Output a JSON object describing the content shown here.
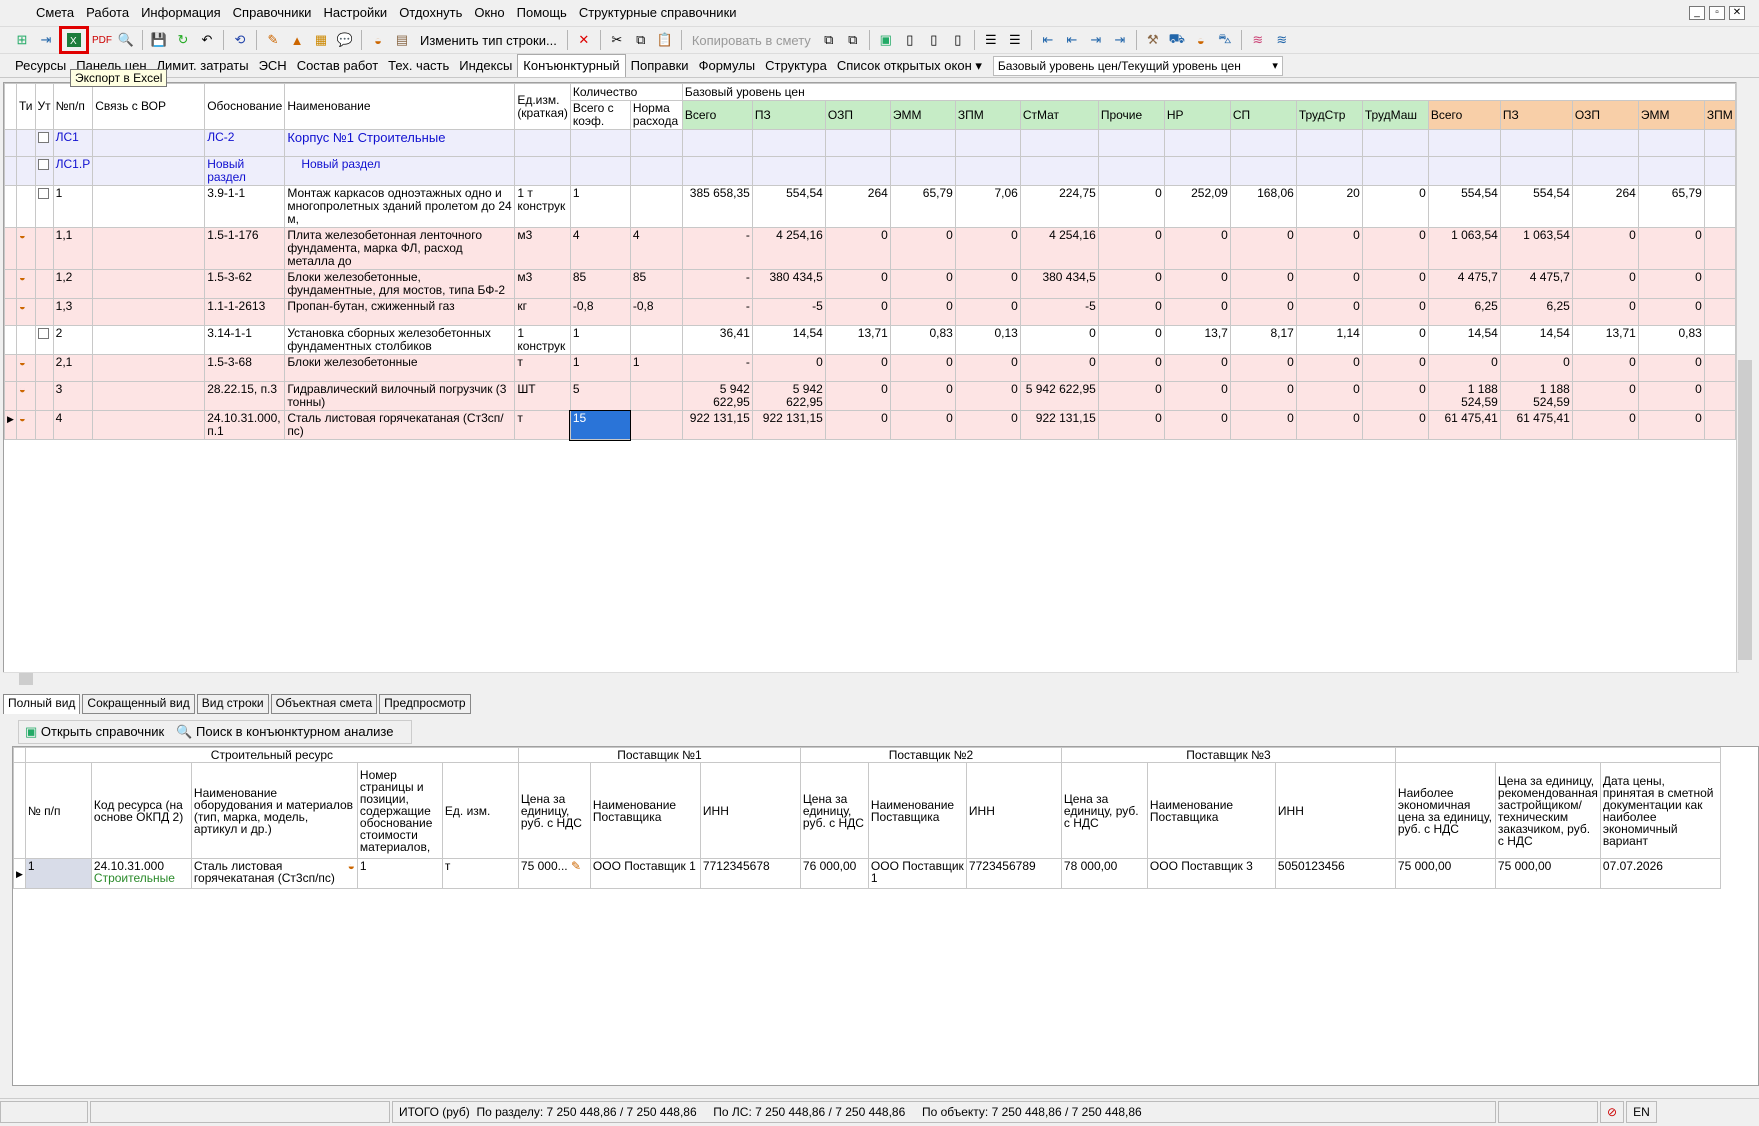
{
  "menu": [
    "Смета",
    "Работа",
    "Информация",
    "Справочники",
    "Настройки",
    "Отдохнуть",
    "Окно",
    "Помощь",
    "Структурные справочники"
  ],
  "toolbar": {
    "change_row_type": "Изменить тип строки...",
    "copy_to_estimate": "Копировать в смету"
  },
  "tooltip": "Экспорт в Excel",
  "tabs": [
    "Ресурсы",
    "Панель цен",
    "Лимит. затраты",
    "ЭСН",
    "Состав работ",
    "Тех. часть",
    "Индексы",
    "Конъюнктурный",
    "Поправки",
    "Формулы",
    "Структура",
    "Список открытых окон"
  ],
  "price_level": "Базовый уровень цен/Текущий уровень цен",
  "grid": {
    "headers": {
      "ti": "Ти",
      "ut": "Ут",
      "num": "№п/п",
      "link": "Связь с ВОР",
      "basis": "Обоснование",
      "name": "Наименование",
      "unit": "Ед.изм. (краткая)",
      "qty": "Количество",
      "qty_total": "Всего с коэф.",
      "qty_norm": "Норма расхода",
      "base_level": "Базовый уровень цен"
    },
    "cost_cols": [
      "Всего",
      "ПЗ",
      "ОЗП",
      "ЭММ",
      "ЗПМ",
      "СтМат",
      "Прочие",
      "НР",
      "СП",
      "ТрудСтр",
      "ТрудМаш",
      "Всего",
      "ПЗ",
      "ОЗП",
      "ЭММ",
      "ЗПМ"
    ],
    "rows": [
      {
        "num": "ЛС1",
        "basis": "ЛС-2",
        "name": "Корпус №1 Строительные",
        "unit": "",
        "qty": "",
        "norm": "",
        "vals": [
          "",
          "",
          "",
          "",
          "",
          "",
          "",
          "",
          "",
          "",
          "",
          "",
          "",
          "",
          "",
          ""
        ]
      },
      {
        "num": "ЛС1.Р",
        "basis": "Новый раздел",
        "name": "Новый раздел",
        "unit": "",
        "qty": "",
        "norm": "",
        "vals": [
          "",
          "",
          "",
          "",
          "",
          "",
          "",
          "",
          "",
          "",
          "",
          "",
          "",
          "",
          "",
          ""
        ]
      },
      {
        "num": "1",
        "basis": "3.9-1-1",
        "name": "Монтаж каркасов одноэтажных одно и многопролетных зданий пролетом до 24 м,",
        "unit": "1 т конструк",
        "qty": "1",
        "norm": "",
        "vals": [
          "385 658,35",
          "554,54",
          "264",
          "65,79",
          "7,06",
          "224,75",
          "0",
          "252,09",
          "168,06",
          "20",
          "0",
          "554,54",
          "554,54",
          "264",
          "65,79",
          ""
        ]
      },
      {
        "num": "1,1",
        "basis": "1.5-1-176",
        "name": "Плита железобетонная ленточного фундамента, марка ФЛ, расход металла до",
        "unit": "м3",
        "qty": "4",
        "norm": "4",
        "vals": [
          "-",
          "4 254,16",
          "0",
          "0",
          "0",
          "4 254,16",
          "0",
          "0",
          "0",
          "0",
          "0",
          "1 063,54",
          "1 063,54",
          "0",
          "0",
          ""
        ]
      },
      {
        "num": "1,2",
        "basis": "1.5-3-62",
        "name": "Блоки железобетонные, фундаментные, для мостов, типа БФ-2",
        "unit": "м3",
        "qty": "85",
        "norm": "85",
        "vals": [
          "-",
          "380 434,5",
          "0",
          "0",
          "0",
          "380 434,5",
          "0",
          "0",
          "0",
          "0",
          "0",
          "4 475,7",
          "4 475,7",
          "0",
          "0",
          ""
        ]
      },
      {
        "num": "1,3",
        "basis": "1.1-1-2613",
        "name": "Пропан-бутан, сжиженный газ",
        "unit": "кг",
        "qty": "-0,8",
        "norm": "-0,8",
        "vals": [
          "-",
          "-5",
          "0",
          "0",
          "0",
          "-5",
          "0",
          "0",
          "0",
          "0",
          "0",
          "6,25",
          "6,25",
          "0",
          "0",
          ""
        ]
      },
      {
        "num": "2",
        "basis": "3.14-1-1",
        "name": "Установка сборных железобетонных фундаментных столбиков",
        "unit": "1 конструк",
        "qty": "1",
        "norm": "",
        "vals": [
          "36,41",
          "14,54",
          "13,71",
          "0,83",
          "0,13",
          "0",
          "0",
          "13,7",
          "8,17",
          "1,14",
          "0",
          "14,54",
          "14,54",
          "13,71",
          "0,83",
          ""
        ]
      },
      {
        "num": "2,1",
        "basis": "1.5-3-68",
        "name": "Блоки железобетонные",
        "unit": "т",
        "qty": "1",
        "norm": "1",
        "vals": [
          "-",
          "0",
          "0",
          "0",
          "0",
          "0",
          "0",
          "0",
          "0",
          "0",
          "0",
          "0",
          "0",
          "0",
          "0",
          ""
        ]
      },
      {
        "num": "3",
        "basis": "28.22.15, п.3",
        "name": "Гидравлический вилочный погрузчик (3 тонны)",
        "unit": "ШТ",
        "qty": "5",
        "norm": "",
        "vals": [
          "5 942 622,95",
          "5 942 622,95",
          "0",
          "0",
          "0",
          "5 942 622,95",
          "0",
          "0",
          "0",
          "0",
          "0",
          "1 188 524,59",
          "1 188 524,59",
          "0",
          "0",
          ""
        ]
      },
      {
        "num": "4",
        "basis": "24.10.31.000, п.1",
        "name": "Сталь листовая горячекатаная (Ст3сп/пс)",
        "unit": "т",
        "qty": "15",
        "norm": "",
        "vals": [
          "922 131,15",
          "922 131,15",
          "0",
          "0",
          "0",
          "922 131,15",
          "0",
          "0",
          "0",
          "0",
          "0",
          "61 475,41",
          "61 475,41",
          "0",
          "0",
          ""
        ]
      }
    ]
  },
  "view_tabs": [
    "Полный вид",
    "Сокращенный вид",
    "Вид строки",
    "Объектная смета",
    "Предпросмотр"
  ],
  "lower_toolbar": {
    "open_ref": "Открыть справочник",
    "search": "Поиск в конъюнктурном анализе"
  },
  "lower": {
    "groups": {
      "resource": "Строительный ресурс",
      "s1": "Поставщик №1",
      "s2": "Поставщик №2",
      "s3": "Поставщик №3"
    },
    "headers": {
      "num": "№ п/п",
      "code": "Код ресурса (на основе ОКПД 2)",
      "name": "Наименование оборудования и материалов (тип, марка, модель, артикул и др.)",
      "page": "Номер страницы и позиции, содержащие обоснование стоимости материалов,",
      "unit": "Ед. изм.",
      "price": "Цена за единицу, руб. с НДС",
      "price2": "Цена за единицу, руб. с НДС",
      "price3": "Цена за единицу, руб. с НДС",
      "sname": "Наименование Поставщика",
      "inn": "ИНН",
      "best": "Наиболее экономичная цена за единицу, руб. с НДС",
      "recommended": "Цена за единицу, рекомендованная застройщиком/ техническим заказчиком, руб. с НДС",
      "date": "Дата цены, принятая в сметной документации как наиболее экономичный вариант"
    },
    "row": {
      "num": "1",
      "code": "24.10.31.000",
      "code_sub": "Строительные",
      "name": "Сталь листовая горячекатаная (Ст3сп/пс)",
      "page": "1",
      "unit": "т",
      "p1": "75 000...",
      "s1": "ООО Поставщик 1",
      "inn1": "7712345678",
      "p2": "76 000,00",
      "s2": "ООО Поставщик 1",
      "inn2": "7723456789",
      "p3": "78 000,00",
      "s3": "ООО Поставщик 3",
      "inn3": "5050123456",
      "best": "75 000,00",
      "rec": "75 000,00",
      "date": "07.07.2026"
    }
  },
  "status": {
    "total": "ИТОГО (руб)",
    "by_section": "По разделу: 7 250 448,86 / 7 250 448,86",
    "by_ls": "По ЛС: 7 250 448,86 / 7 250 448,86",
    "by_object": "По объекту: 7 250 448,86 / 7 250 448,86",
    "lang": "EN"
  }
}
